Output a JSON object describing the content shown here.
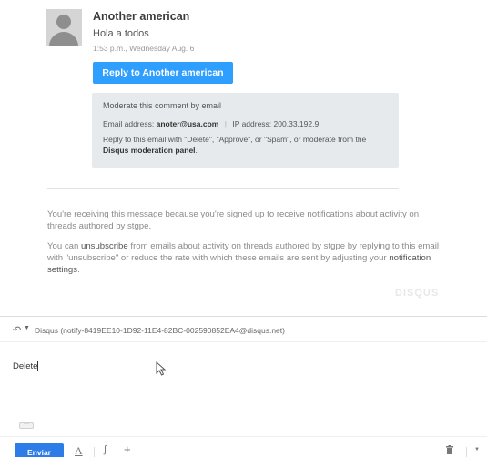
{
  "comment": {
    "author": "Another american",
    "text": "Hola a todos",
    "timestamp": "1:53 p.m., Wednesday Aug. 6",
    "reply_button": "Reply to Another american"
  },
  "moderation": {
    "title": "Moderate this comment by email",
    "email_label": "Email address:",
    "email_value": "anoter@usa.com",
    "ip_label": "IP address:",
    "ip_value": "200.33.192.9",
    "reply_text_1": "Reply to this email with \"Delete\", \"Approve\", or \"Spam\", or moderate from the",
    "panel_link": "Disqus moderation panel",
    "reply_text_2": "."
  },
  "notices": {
    "receiving": "You're receiving this message because you're signed up to receive notifications about activity on threads authored by stgpe.",
    "unsub_prefix": "You can",
    "unsubscribe": "unsubscribe",
    "unsub_middle": "from emails about activity on threads authored by stgpe by replying to this email with \"unsubscribe\" or reduce the rate with which these emails are sent by adjusting your",
    "notification_settings": "notification settings",
    "unsub_suffix": "."
  },
  "brand": {
    "logo_text": "DISQUS"
  },
  "compose": {
    "recipient": "Disqus (notify-8419EE10-1D92-11E4-82BC-002590852EA4@disqus.net)",
    "body": "Delete",
    "trim_label": "···",
    "send_label": "Enviar",
    "format_label": "A",
    "insert_label": "+"
  },
  "icons": {
    "reply": "reply-icon",
    "caret": "chevron-down-icon",
    "attach": "paperclip-icon",
    "trash": "trash-icon",
    "format": "text-format-icon"
  },
  "colors": {
    "reply_button": "#2e9fff",
    "send_button": "#2e7ce8",
    "moderate_box": "#e7eaec"
  }
}
